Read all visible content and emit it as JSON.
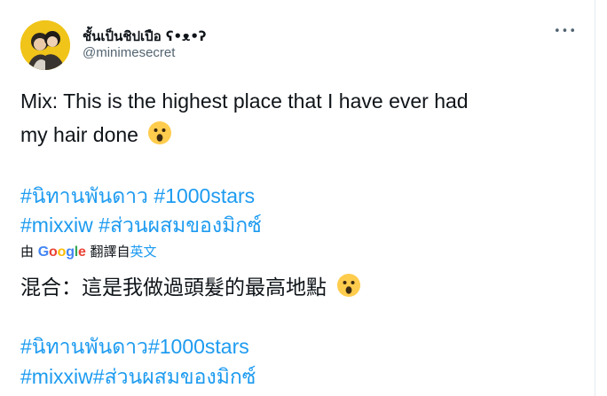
{
  "author": {
    "display_name": "ชั้นเป็นชิปเปือ ʕ•ᴥ•ʔ",
    "handle": "@minimesecret"
  },
  "more_menu": "•••",
  "tweet": {
    "text_line1": "Mix: This is the highest place that I have ever had",
    "text_line2": "my hair done",
    "emoji": "surprised-face",
    "hashtags_line1": [
      "#นิทานพันดาว",
      "#1000stars"
    ],
    "hashtags_line2": [
      "#mixxiw",
      "#ส่วนผสมของมิกซ์"
    ]
  },
  "translation": {
    "prefix": "由",
    "provider": "Google",
    "label": "翻譯自",
    "source_language": "英文",
    "text_line1": "混合：這是我做過頭髮的最高地點",
    "hashtags_line1": "#นิทานพันดาว#1000stars",
    "hashtags_line2": "#mixxiw#ส่วนผสมของมิกซ์"
  },
  "colors": {
    "link": "#1d9bf0",
    "secondary_text": "#536471",
    "avatar_bg": "#f0c419"
  }
}
